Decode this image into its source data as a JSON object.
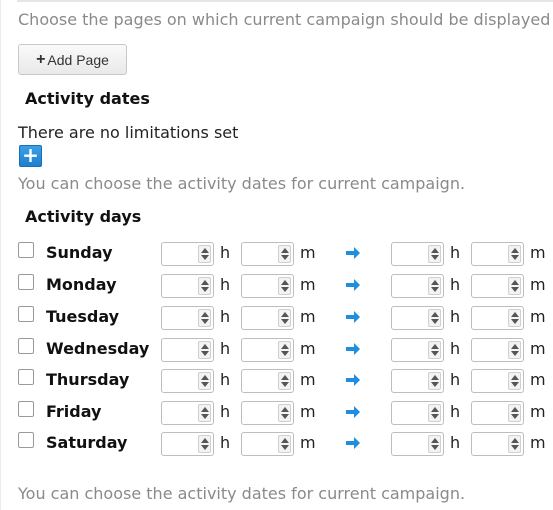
{
  "pages": {
    "help": "Choose the pages on which current campaign should be displayed",
    "add_page_plus": "+",
    "add_page_label": "Add Page"
  },
  "activity_dates": {
    "title": "Activity dates",
    "status": "There are no limitations set",
    "add_icon": "+",
    "help": "You can choose the activity dates for current campaign."
  },
  "activity_days": {
    "title": "Activity days",
    "hour_unit": "h",
    "minute_unit": "m",
    "days": [
      {
        "label": "Sunday",
        "checked": false
      },
      {
        "label": "Monday",
        "checked": false
      },
      {
        "label": "Tuesday",
        "checked": false
      },
      {
        "label": "Wednesday",
        "checked": false
      },
      {
        "label": "Thursday",
        "checked": false
      },
      {
        "label": "Friday",
        "checked": false
      },
      {
        "label": "Saturday",
        "checked": false
      }
    ],
    "help": "You can choose the activity dates for current campaign."
  },
  "colors": {
    "accent": "#1f8ee0",
    "help_text": "#8a8a8a"
  },
  "icons": {
    "arrow": "arrow-right-icon",
    "add": "plus-icon"
  }
}
